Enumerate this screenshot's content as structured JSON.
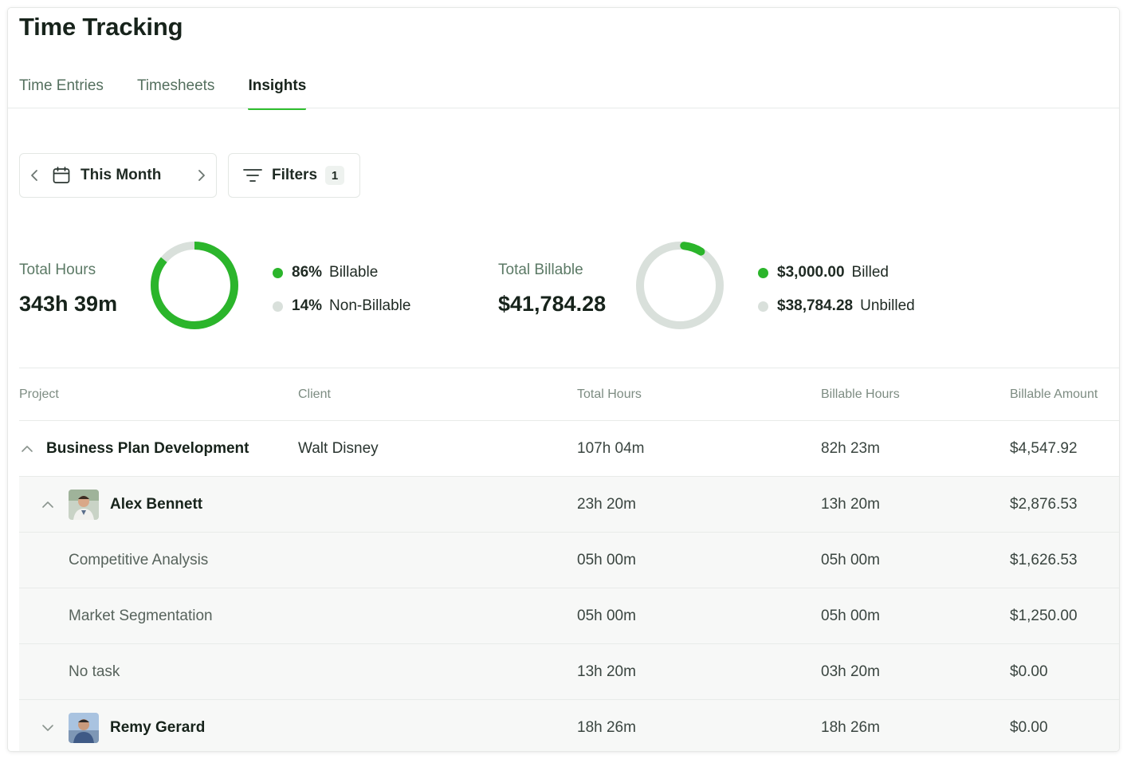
{
  "page": {
    "title": "Time Tracking"
  },
  "tabs": [
    {
      "label": "Time Entries",
      "active": false
    },
    {
      "label": "Timesheets",
      "active": false
    },
    {
      "label": "Insights",
      "active": true
    }
  ],
  "controls": {
    "date_range": "This Month",
    "filters_label": "Filters",
    "filters_count": "1"
  },
  "hours_summary": {
    "label": "Total Hours",
    "value": "343h 39m",
    "billable_fraction": 0.86,
    "legend": [
      {
        "value": "86%",
        "label": "Billable",
        "color": "#2bb52b"
      },
      {
        "value": "14%",
        "label": "Non-Billable",
        "color": "#d9e0db"
      }
    ]
  },
  "billable_summary": {
    "label": "Total Billable",
    "value": "$41,784.28",
    "billed_fraction": 0.072,
    "legend": [
      {
        "value": "$3,000.00",
        "label": "Billed",
        "color": "#2bb52b"
      },
      {
        "value": "$38,784.28",
        "label": "Unbilled",
        "color": "#d9e0db"
      }
    ]
  },
  "table": {
    "columns": [
      "Project",
      "Client",
      "Total Hours",
      "Billable Hours",
      "Billable Amount"
    ],
    "project_row": {
      "project": "Business Plan Development",
      "client": "Walt Disney",
      "total_hours": "107h 04m",
      "billable_hours": "82h 23m",
      "billable_amount": "$4,547.92"
    },
    "members": [
      {
        "name": "Alex Bennett",
        "total_hours": "23h 20m",
        "billable_hours": "13h 20m",
        "billable_amount": "$2,876.53",
        "expanded": true,
        "tasks": [
          {
            "name": "Competitive Analysis",
            "total_hours": "05h 00m",
            "billable_hours": "05h 00m",
            "billable_amount": "$1,626.53"
          },
          {
            "name": "Market Segmentation",
            "total_hours": "05h 00m",
            "billable_hours": "05h 00m",
            "billable_amount": "$1,250.00"
          },
          {
            "name": "No task",
            "total_hours": "13h 20m",
            "billable_hours": "03h 20m",
            "billable_amount": "$0.00"
          }
        ]
      },
      {
        "name": "Remy Gerard",
        "total_hours": "18h 26m",
        "billable_hours": "18h 26m",
        "billable_amount": "$0.00",
        "expanded": false
      }
    ]
  },
  "colors": {
    "accent": "#2bb52b",
    "track": "#d9e0db",
    "muted_text": "#5c7a66"
  }
}
